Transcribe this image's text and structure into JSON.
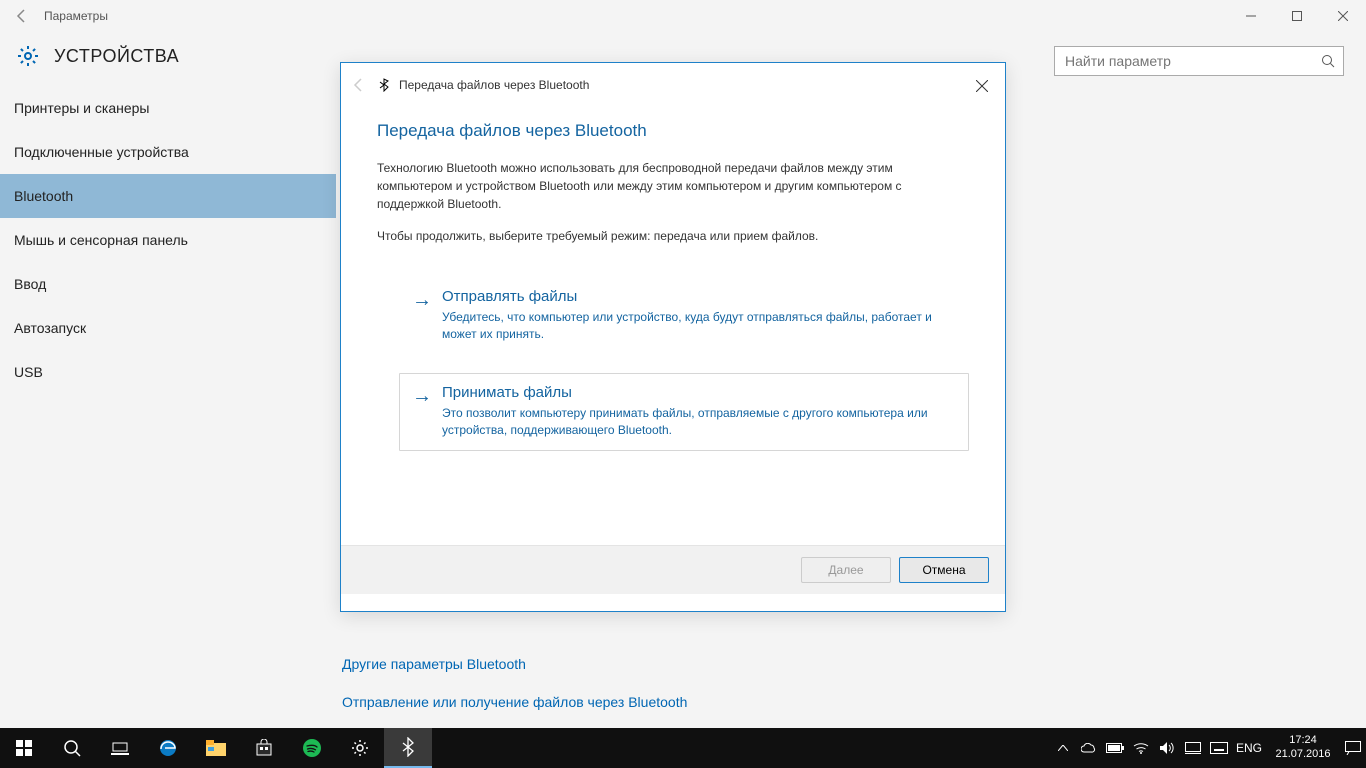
{
  "window": {
    "title": "Параметры"
  },
  "header": {
    "title": "УСТРОЙСТВА"
  },
  "search": {
    "placeholder": "Найти параметр"
  },
  "sidebar": {
    "items": [
      {
        "label": "Принтеры и сканеры",
        "sel": false
      },
      {
        "label": "Подключенные устройства",
        "sel": false
      },
      {
        "label": "Bluetooth",
        "sel": true
      },
      {
        "label": "Мышь и сенсорная панель",
        "sel": false
      },
      {
        "label": "Ввод",
        "sel": false
      },
      {
        "label": "Автозапуск",
        "sel": false
      },
      {
        "label": "USB",
        "sel": false
      }
    ]
  },
  "main": {
    "links": [
      "Другие параметры Bluetooth",
      "Отправление или получение файлов через Bluetooth"
    ]
  },
  "dialog": {
    "title": "Передача файлов через Bluetooth",
    "heading": "Передача файлов через Bluetooth",
    "p1": "Технологию Bluetooth можно использовать для беспроводной передачи файлов между этим компьютером и устройством Bluetooth или между этим компьютером и другим компьютером с поддержкой Bluetooth.",
    "p2": "Чтобы продолжить, выберите требуемый режим: передача или прием файлов.",
    "options": [
      {
        "title": "Отправлять файлы",
        "desc": "Убедитесь, что компьютер или устройство, куда будут отправляться файлы, работает и может их принять."
      },
      {
        "title": "Принимать файлы",
        "desc": "Это позволит компьютеру принимать файлы, отправляемые с другого компьютера или устройства, поддерживающего Bluetooth."
      }
    ],
    "next": "Далее",
    "cancel": "Отмена"
  },
  "tray": {
    "lang": "ENG",
    "time": "17:24",
    "date": "21.07.2016"
  }
}
